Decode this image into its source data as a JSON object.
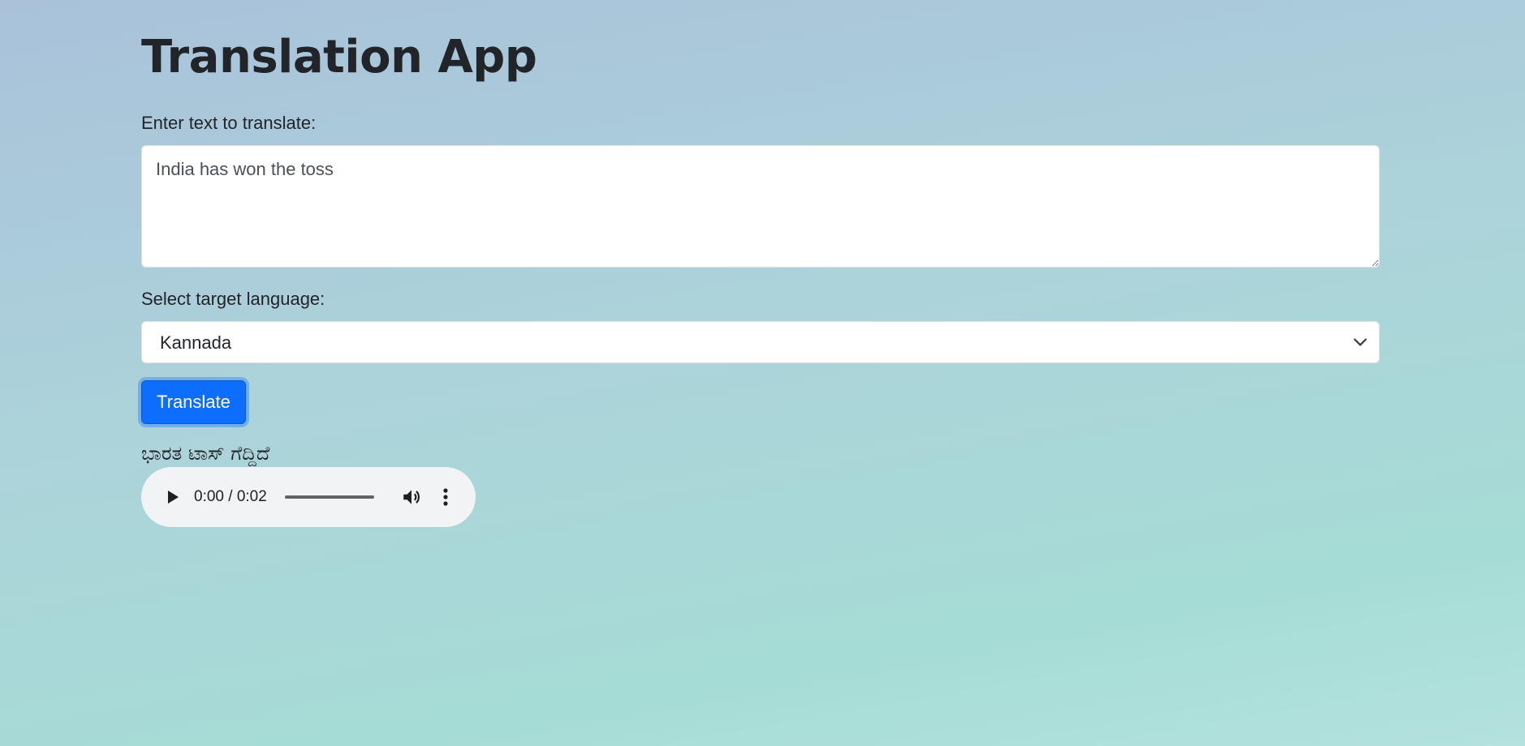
{
  "app": {
    "title": "Translation App"
  },
  "form": {
    "text_label": "Enter text to translate:",
    "text_value": "India has won the toss",
    "language_label": "Select target language:",
    "language_selected": "Kannada",
    "translate_button": "Translate"
  },
  "result": {
    "translated_text": "ಭಾರತ ಟಾಸ್ ಗೆದ್ದಿದೆ"
  },
  "audio_player": {
    "time_display": "0:00 / 0:02",
    "progress": 0,
    "icons": [
      "play-icon",
      "volume-icon",
      "more-options-icon"
    ]
  },
  "colors": {
    "accent": "#0d6efd",
    "player_background": "#f1f3f4"
  }
}
